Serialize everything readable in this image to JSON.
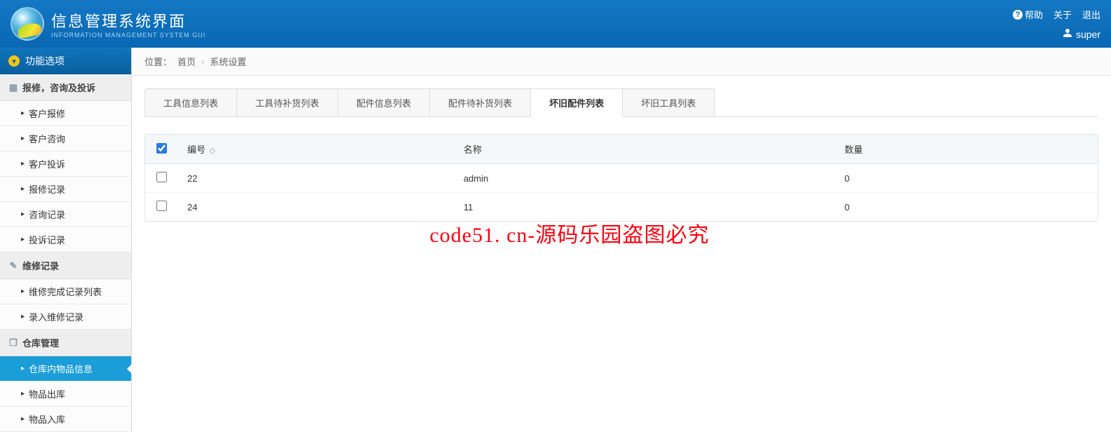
{
  "header": {
    "title": "信息管理系统界面",
    "subtitle": "INFORMATION MANAGEMENT SYSTEM GUI",
    "links": {
      "help": "帮助",
      "about": "关于",
      "logout": "退出"
    },
    "user": "super"
  },
  "sidebar": {
    "func_header": "功能选项",
    "sections": [
      {
        "title": "报修，咨询及投诉",
        "items": [
          "客户报修",
          "客户咨询",
          "客户投诉",
          "报修记录",
          "咨询记录",
          "投诉记录"
        ]
      },
      {
        "title": "维修记录",
        "items": [
          "维修完成记录列表",
          "录入维修记录"
        ]
      },
      {
        "title": "仓库管理",
        "items": [
          "仓库内物品信息",
          "物品出库",
          "物品入库"
        ],
        "active_index": 0
      }
    ]
  },
  "breadcrumb": {
    "label": "位置：",
    "home": "首页",
    "current": "系统设置"
  },
  "tabs": {
    "items": [
      "工具信息列表",
      "工具待补货列表",
      "配件信息列表",
      "配件待补货列表",
      "坏旧配件列表",
      "坏旧工具列表"
    ],
    "active_index": 4
  },
  "table": {
    "columns": {
      "check": "",
      "id": "编号",
      "name": "名称",
      "qty": "数量"
    },
    "sort_indicator": "◇",
    "header_checked": true,
    "rows": [
      {
        "checked": false,
        "id": "22",
        "name": "admin",
        "qty": "0"
      },
      {
        "checked": false,
        "id": "24",
        "name": "11",
        "qty": "0"
      }
    ]
  },
  "watermark": "code51. cn-源码乐园盗图必究"
}
